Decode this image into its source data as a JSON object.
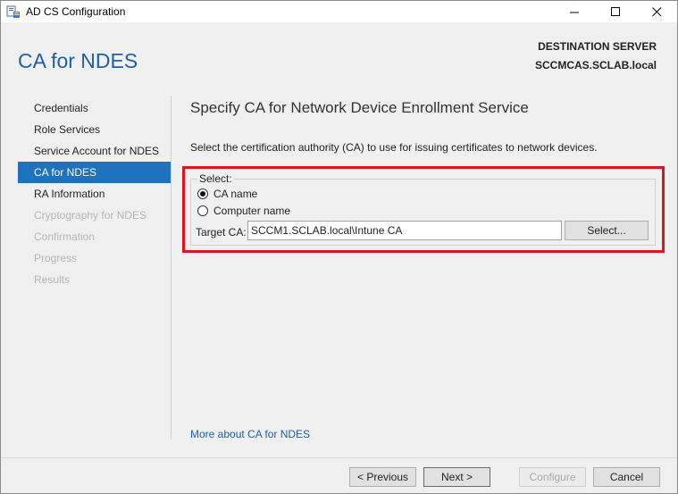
{
  "window": {
    "title": "AD CS Configuration",
    "controls": {
      "minimize_icon": "minimize-icon",
      "maximize_icon": "maximize-icon",
      "close_icon": "close-icon"
    }
  },
  "header": {
    "page_title": "CA for NDES",
    "destination_label": "DESTINATION SERVER",
    "destination_server": "SCCMCAS.SCLAB.local"
  },
  "sidebar": {
    "items": [
      {
        "label": "Credentials",
        "state": "normal"
      },
      {
        "label": "Role Services",
        "state": "normal"
      },
      {
        "label": "Service Account for NDES",
        "state": "normal"
      },
      {
        "label": "CA for NDES",
        "state": "active"
      },
      {
        "label": "RA Information",
        "state": "normal"
      },
      {
        "label": "Cryptography for NDES",
        "state": "disabled"
      },
      {
        "label": "Confirmation",
        "state": "disabled"
      },
      {
        "label": "Progress",
        "state": "disabled"
      },
      {
        "label": "Results",
        "state": "disabled"
      }
    ]
  },
  "main": {
    "section_title": "Specify CA for Network Device Enrollment Service",
    "description": "Select the certification authority (CA) to use for issuing certificates to network devices.",
    "select_group": {
      "legend": "Select:",
      "options": [
        {
          "label": "CA name",
          "checked": true
        },
        {
          "label": "Computer name",
          "checked": false
        }
      ],
      "target_label": "Target CA:",
      "target_value": "SCCM1.SCLAB.local\\Intune CA",
      "select_button": "Select..."
    },
    "more_link": "More about CA for NDES"
  },
  "footer": {
    "previous": "< Previous",
    "next": "Next >",
    "configure": "Configure",
    "cancel": "Cancel"
  },
  "colors": {
    "accent": "#1f72be",
    "title_blue": "#1f5fa8",
    "highlight_red": "#e0141e",
    "panel_bg": "#f0f0f0"
  }
}
